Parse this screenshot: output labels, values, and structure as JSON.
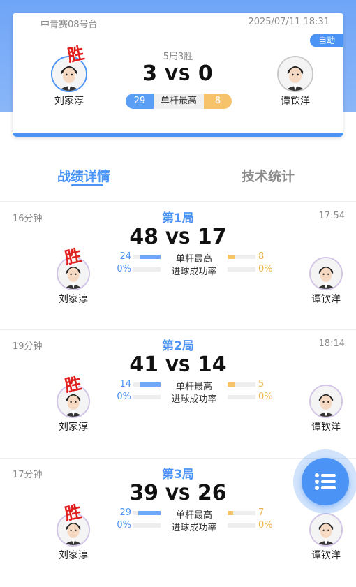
{
  "match": {
    "venue": "中青赛08号台",
    "datetime": "2025/07/11 18:31",
    "mode_badge": "自动",
    "format": "5局3胜",
    "score_left": "3",
    "vs": "VS",
    "score_right": "0",
    "win_mark": "胜",
    "high_break": {
      "left": "29",
      "label": "单杆最高",
      "right": "8"
    },
    "player_left": "刘家淳",
    "player_right": "谭钦洋"
  },
  "tabs": {
    "active": "战绩详情",
    "inactive": "技术统计"
  },
  "frames": [
    {
      "title": "第1局",
      "duration": "16分钟",
      "time": "17:54",
      "score_left": "48",
      "vs": "VS",
      "score_right": "17",
      "win_mark": "胜",
      "player_left": "刘家淳",
      "player_right": "谭钦洋",
      "break_label": "单杆最高",
      "break_left": "24",
      "break_right": "8",
      "break_left_ratio": 0.75,
      "break_right_ratio": 0.25,
      "rate_label": "进球成功率",
      "rate_left": "0%",
      "rate_right": "0%"
    },
    {
      "title": "第2局",
      "duration": "19分钟",
      "time": "18:14",
      "score_left": "41",
      "vs": "VS",
      "score_right": "14",
      "win_mark": "胜",
      "player_left": "刘家淳",
      "player_right": "谭钦洋",
      "break_label": "单杆最高",
      "break_left": "14",
      "break_right": "5",
      "break_left_ratio": 0.74,
      "break_right_ratio": 0.26,
      "rate_label": "进球成功率",
      "rate_left": "0%",
      "rate_right": "0%"
    },
    {
      "title": "第3局",
      "duration": "17分钟",
      "time": "",
      "score_left": "39",
      "vs": "VS",
      "score_right": "26",
      "win_mark": "胜",
      "player_left": "刘家淳",
      "player_right": "谭钦洋",
      "break_label": "单杆最高",
      "break_left": "29",
      "break_right": "7",
      "break_left_ratio": 0.8,
      "break_right_ratio": 0.2,
      "rate_label": "进球成功率",
      "rate_left": "0%",
      "rate_right": "0%"
    }
  ],
  "colors": {
    "accent": "#4b93f5",
    "opponent": "#f6c36a",
    "win": "#e02020"
  },
  "icons": {
    "fab": "list-icon",
    "avatar": "avatar-icon"
  }
}
